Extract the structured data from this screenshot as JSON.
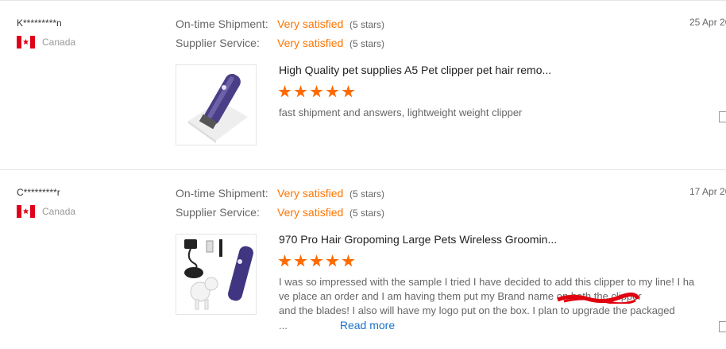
{
  "reviews": [
    {
      "buyer": "K*********n",
      "country": "Canada",
      "ratings": [
        {
          "label": "On-time Shipment:",
          "value": "Very satisfied",
          "stars": "(5 stars)"
        },
        {
          "label": "Supplier Service:",
          "value": "Very satisfied",
          "stars": "(5 stars)"
        }
      ],
      "date": "25 Apr 20",
      "product_title": "High Quality pet supplies A5 Pet clipper pet hair remo...",
      "product_rating": 5,
      "comment": "fast shipment and answers,  lightweight weight clipper"
    },
    {
      "buyer": "C*********r",
      "country": "Canada",
      "ratings": [
        {
          "label": "On-time Shipment:",
          "value": "Very satisfied",
          "stars": "(5 stars)"
        },
        {
          "label": "Supplier Service:",
          "value": "Very satisfied",
          "stars": "(5 stars)"
        }
      ],
      "date": "17 Apr 20",
      "product_title": "970 Pro Hair Gropoming Large Pets Wireless Groomin...",
      "product_rating": 5,
      "comment_lines": [
        "I was so impressed with the sample I tried I have decided to add this clipper to my line! I ha",
        "ve place an order and I am having them put my Brand name on both the clipper",
        "and the blades! I also will have my logo put on the box. I plan to upgrade the packaged"
      ],
      "comment_ellipsis": "...",
      "read_more": "Read more"
    }
  ],
  "colors": {
    "accent": "#ff7500",
    "star": "#ff6a00",
    "link": "#1a73c8"
  },
  "icons": [
    "canada-flag-icon",
    "star-icon",
    "helpful-icon"
  ]
}
